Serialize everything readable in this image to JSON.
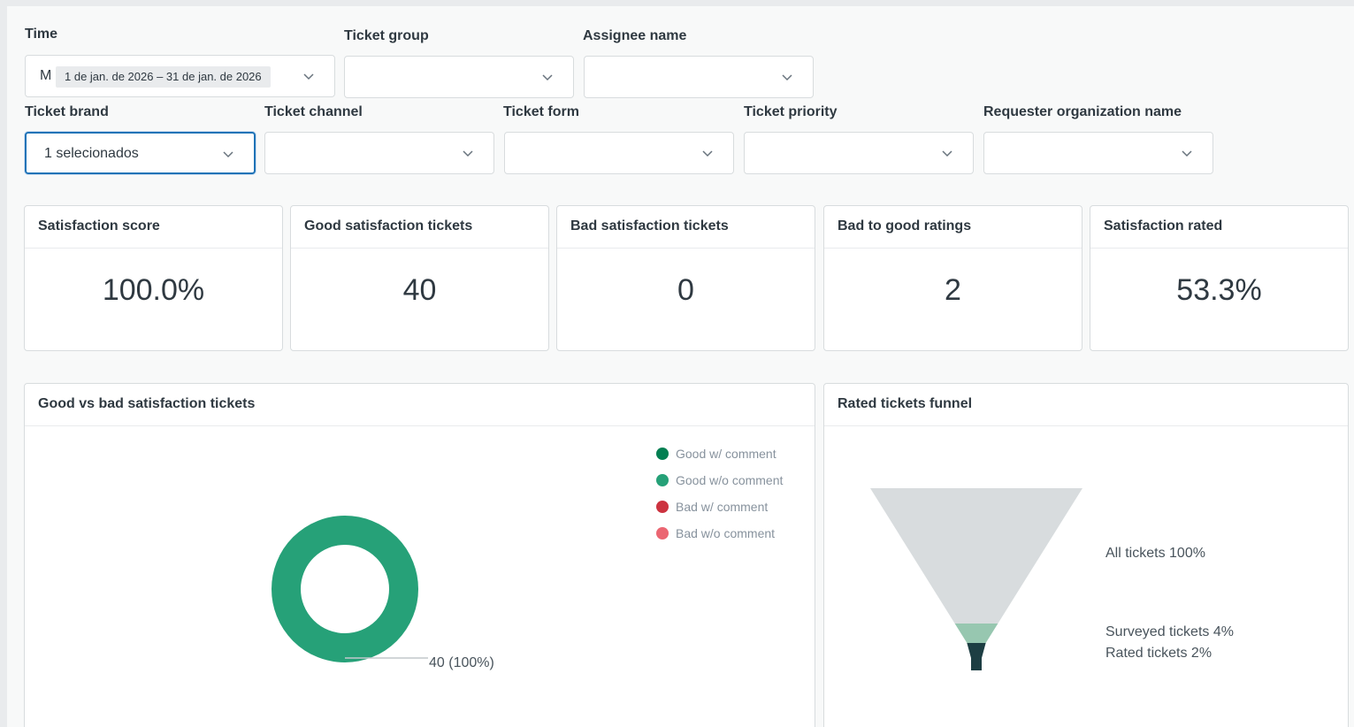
{
  "filters": {
    "time": {
      "label": "Time",
      "prefix": "M",
      "range": "1 de jan. de 2026 – 31 de jan. de 2026"
    },
    "ticket_group": {
      "label": "Ticket group",
      "value": ""
    },
    "assignee_name": {
      "label": "Assignee name",
      "value": ""
    },
    "ticket_brand": {
      "label": "Ticket brand",
      "value": "1 selecionados"
    },
    "ticket_channel": {
      "label": "Ticket channel",
      "value": ""
    },
    "ticket_form": {
      "label": "Ticket form",
      "value": ""
    },
    "ticket_priority": {
      "label": "Ticket priority",
      "value": ""
    },
    "requester_org": {
      "label": "Requester organization name",
      "value": ""
    }
  },
  "metrics": [
    {
      "title": "Satisfaction score",
      "value": "100.0%"
    },
    {
      "title": "Good satisfaction tickets",
      "value": "40"
    },
    {
      "title": "Bad satisfaction tickets",
      "value": "0"
    },
    {
      "title": "Bad to good ratings",
      "value": "2"
    },
    {
      "title": "Satisfaction rated",
      "value": "53.3%"
    }
  ],
  "donut_card": {
    "title": "Good vs bad satisfaction tickets",
    "legend": [
      {
        "label": "Good w/ comment",
        "color": "#037f52"
      },
      {
        "label": "Good w/o comment",
        "color": "#26a178"
      },
      {
        "label": "Bad w/ comment",
        "color": "#cc3340"
      },
      {
        "label": "Bad w/o comment",
        "color": "#eb6672"
      }
    ],
    "slice_label": "40 (100%)"
  },
  "funnel_card": {
    "title": "Rated tickets funnel",
    "labels": [
      "All tickets 100%",
      "Surveyed tickets 4%",
      "Rated tickets 2%"
    ]
  },
  "chart_data": [
    {
      "type": "pie",
      "categories": [
        "Good w/ comment",
        "Good w/o comment",
        "Bad w/ comment",
        "Bad w/o comment"
      ],
      "values": [
        0,
        40,
        0,
        0
      ],
      "colors": [
        "#037f52",
        "#26a178",
        "#cc3340",
        "#eb6672"
      ],
      "title": "Good vs bad satisfaction tickets",
      "data_labels": [
        "40 (100%)"
      ],
      "legend": "top-right"
    },
    {
      "type": "funnel",
      "categories": [
        "All tickets",
        "Surveyed tickets",
        "Rated tickets"
      ],
      "values": [
        100,
        4,
        2
      ],
      "colors": [
        "#d8dcde",
        "#97c7b0",
        "#1d3e43"
      ],
      "title": "Rated tickets funnel"
    }
  ],
  "icons": {
    "dropdown": "chevron-down-icon"
  }
}
